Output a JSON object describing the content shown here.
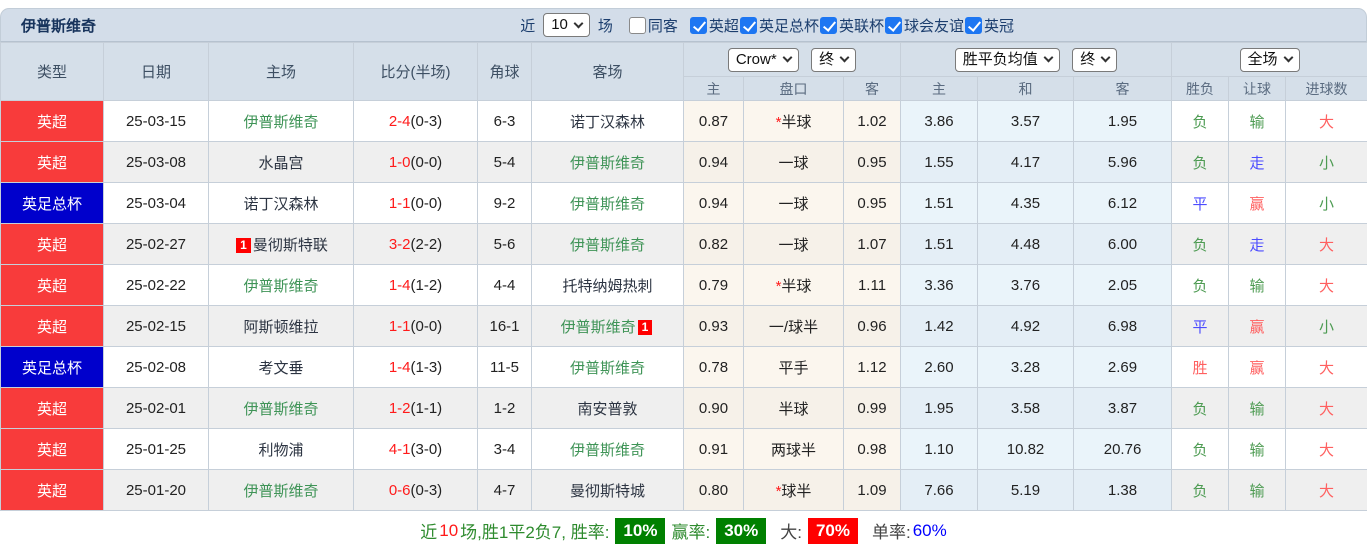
{
  "title": "伊普斯维奇",
  "colors": {
    "topbar_bg": "#d3dde9",
    "header_bg": "#d5dfe9",
    "league_red_badge": "#f83b3b",
    "league_blue_badge": "#0000cc",
    "row_alt_bg": "#efefef",
    "odds_column_bg": "#fbf6ee",
    "avg_column_bg": "#eaf4fa",
    "team_highlight_green": "#3f9457",
    "score_red": "#ff1a1a",
    "result_green": "#4d9b52",
    "result_blue": "#4c4cff",
    "result_red": "#ff6060",
    "rate_green_bg": "#008000",
    "rate_red_bg": "#ff0000",
    "single_rate_blue": "#0000ff",
    "checkbox_blue": "#1d76f2"
  },
  "topbar": {
    "recent_label": "近",
    "recent_value": "10",
    "games_label": "场",
    "filters": [
      {
        "label": "同客",
        "checked": false
      },
      {
        "label": "英超",
        "checked": true
      },
      {
        "label": "英足总杯",
        "checked": true
      },
      {
        "label": "英联杯",
        "checked": true
      },
      {
        "label": "球会友谊",
        "checked": true
      },
      {
        "label": "英冠",
        "checked": true
      }
    ]
  },
  "table": {
    "headers": {
      "type": "类型",
      "date": "日期",
      "home": "主场",
      "score": "比分(半场)",
      "corner": "角球",
      "away": "客场",
      "sub": [
        "主",
        "盘口",
        "客",
        "主",
        "和",
        "客",
        "胜负",
        "让球",
        "进球数"
      ]
    },
    "selects": {
      "company": "Crow*",
      "company_time": "终",
      "avg": "胜平负均值",
      "avg_time": "终",
      "scope": "全场"
    },
    "rows": [
      {
        "league": "英超",
        "league_color": "red",
        "date": "25-03-15",
        "home": "伊普斯维奇",
        "home_highlight": true,
        "home_card": "",
        "score": "2-4",
        "half": "(0-3)",
        "corner": "6-3",
        "away": "诺丁汉森林",
        "away_highlight": false,
        "away_card": "",
        "odds_home": "0.87",
        "handicap": "*半球",
        "odds_away": "1.02",
        "avg_home": "3.86",
        "avg_draw": "3.57",
        "avg_away": "1.95",
        "result_wdl": {
          "text": "负",
          "color": "green"
        },
        "result_handicap": {
          "text": "输",
          "color": "green"
        },
        "result_goals": {
          "text": "大",
          "color": "red"
        }
      },
      {
        "league": "英超",
        "league_color": "red",
        "date": "25-03-08",
        "home": "水晶宫",
        "home_highlight": false,
        "home_card": "",
        "score": "1-0",
        "half": "(0-0)",
        "corner": "5-4",
        "away": "伊普斯维奇",
        "away_highlight": true,
        "away_card": "",
        "odds_home": "0.94",
        "handicap": "一球",
        "odds_away": "0.95",
        "avg_home": "1.55",
        "avg_draw": "4.17",
        "avg_away": "5.96",
        "result_wdl": {
          "text": "负",
          "color": "green"
        },
        "result_handicap": {
          "text": "走",
          "color": "blue"
        },
        "result_goals": {
          "text": "小",
          "color": "green"
        }
      },
      {
        "league": "英足总杯",
        "league_color": "blue",
        "date": "25-03-04",
        "home": "诺丁汉森林",
        "home_highlight": false,
        "home_card": "",
        "score": "1-1",
        "half": "(0-0)",
        "corner": "9-2",
        "away": "伊普斯维奇",
        "away_highlight": true,
        "away_card": "",
        "odds_home": "0.94",
        "handicap": "一球",
        "odds_away": "0.95",
        "avg_home": "1.51",
        "avg_draw": "4.35",
        "avg_away": "6.12",
        "result_wdl": {
          "text": "平",
          "color": "blue"
        },
        "result_handicap": {
          "text": "赢",
          "color": "red"
        },
        "result_goals": {
          "text": "小",
          "color": "green"
        }
      },
      {
        "league": "英超",
        "league_color": "red",
        "date": "25-02-27",
        "home": "曼彻斯特联",
        "home_highlight": false,
        "home_card": "1",
        "score": "3-2",
        "half": "(2-2)",
        "corner": "5-6",
        "away": "伊普斯维奇",
        "away_highlight": true,
        "away_card": "",
        "odds_home": "0.82",
        "handicap": "一球",
        "odds_away": "1.07",
        "avg_home": "1.51",
        "avg_draw": "4.48",
        "avg_away": "6.00",
        "result_wdl": {
          "text": "负",
          "color": "green"
        },
        "result_handicap": {
          "text": "走",
          "color": "blue"
        },
        "result_goals": {
          "text": "大",
          "color": "red"
        }
      },
      {
        "league": "英超",
        "league_color": "red",
        "date": "25-02-22",
        "home": "伊普斯维奇",
        "home_highlight": true,
        "home_card": "",
        "score": "1-4",
        "half": "(1-2)",
        "corner": "4-4",
        "away": "托特纳姆热刺",
        "away_highlight": false,
        "away_card": "",
        "odds_home": "0.79",
        "handicap": "*半球",
        "odds_away": "1.11",
        "avg_home": "3.36",
        "avg_draw": "3.76",
        "avg_away": "2.05",
        "result_wdl": {
          "text": "负",
          "color": "green"
        },
        "result_handicap": {
          "text": "输",
          "color": "green"
        },
        "result_goals": {
          "text": "大",
          "color": "red"
        }
      },
      {
        "league": "英超",
        "league_color": "red",
        "date": "25-02-15",
        "home": "阿斯顿维拉",
        "home_highlight": false,
        "home_card": "",
        "score": "1-1",
        "half": "(0-0)",
        "corner": "16-1",
        "away": "伊普斯维奇",
        "away_highlight": true,
        "away_card": "1",
        "odds_home": "0.93",
        "handicap": "一/球半",
        "odds_away": "0.96",
        "avg_home": "1.42",
        "avg_draw": "4.92",
        "avg_away": "6.98",
        "result_wdl": {
          "text": "平",
          "color": "blue"
        },
        "result_handicap": {
          "text": "赢",
          "color": "red"
        },
        "result_goals": {
          "text": "小",
          "color": "green"
        }
      },
      {
        "league": "英足总杯",
        "league_color": "blue",
        "date": "25-02-08",
        "home": "考文垂",
        "home_highlight": false,
        "home_card": "",
        "score": "1-4",
        "half": "(1-3)",
        "corner": "11-5",
        "away": "伊普斯维奇",
        "away_highlight": true,
        "away_card": "",
        "odds_home": "0.78",
        "handicap": "平手",
        "odds_away": "1.12",
        "avg_home": "2.60",
        "avg_draw": "3.28",
        "avg_away": "2.69",
        "result_wdl": {
          "text": "胜",
          "color": "red"
        },
        "result_handicap": {
          "text": "赢",
          "color": "red"
        },
        "result_goals": {
          "text": "大",
          "color": "red"
        }
      },
      {
        "league": "英超",
        "league_color": "red",
        "date": "25-02-01",
        "home": "伊普斯维奇",
        "home_highlight": true,
        "home_card": "",
        "score": "1-2",
        "half": "(1-1)",
        "corner": "1-2",
        "away": "南安普敦",
        "away_highlight": false,
        "away_card": "",
        "odds_home": "0.90",
        "handicap": "半球",
        "odds_away": "0.99",
        "avg_home": "1.95",
        "avg_draw": "3.58",
        "avg_away": "3.87",
        "result_wdl": {
          "text": "负",
          "color": "green"
        },
        "result_handicap": {
          "text": "输",
          "color": "green"
        },
        "result_goals": {
          "text": "大",
          "color": "red"
        }
      },
      {
        "league": "英超",
        "league_color": "red",
        "date": "25-01-25",
        "home": "利物浦",
        "home_highlight": false,
        "home_card": "",
        "score": "4-1",
        "half": "(3-0)",
        "corner": "3-4",
        "away": "伊普斯维奇",
        "away_highlight": true,
        "away_card": "",
        "odds_home": "0.91",
        "handicap": "两球半",
        "odds_away": "0.98",
        "avg_home": "1.10",
        "avg_draw": "10.82",
        "avg_away": "20.76",
        "result_wdl": {
          "text": "负",
          "color": "green"
        },
        "result_handicap": {
          "text": "输",
          "color": "green"
        },
        "result_goals": {
          "text": "大",
          "color": "red"
        }
      },
      {
        "league": "英超",
        "league_color": "red",
        "date": "25-01-20",
        "home": "伊普斯维奇",
        "home_highlight": true,
        "home_card": "",
        "score": "0-6",
        "half": "(0-3)",
        "corner": "4-7",
        "away": "曼彻斯特城",
        "away_highlight": false,
        "away_card": "",
        "odds_home": "0.80",
        "handicap": "*球半",
        "odds_away": "1.09",
        "avg_home": "7.66",
        "avg_draw": "5.19",
        "avg_away": "1.38",
        "result_wdl": {
          "text": "负",
          "color": "green"
        },
        "result_handicap": {
          "text": "输",
          "color": "green"
        },
        "result_goals": {
          "text": "大",
          "color": "red"
        }
      }
    ]
  },
  "summary": {
    "seg_recent": "近",
    "seg_count": "10",
    "seg_record": "场,胜1平2负7, 胜率:",
    "win_rate": "10%",
    "seg_win_odds": "赢率:",
    "win_odds_rate": "30%",
    "seg_big": "大:",
    "big_rate": "70%",
    "seg_single": "单率:",
    "single_rate": "60%"
  }
}
